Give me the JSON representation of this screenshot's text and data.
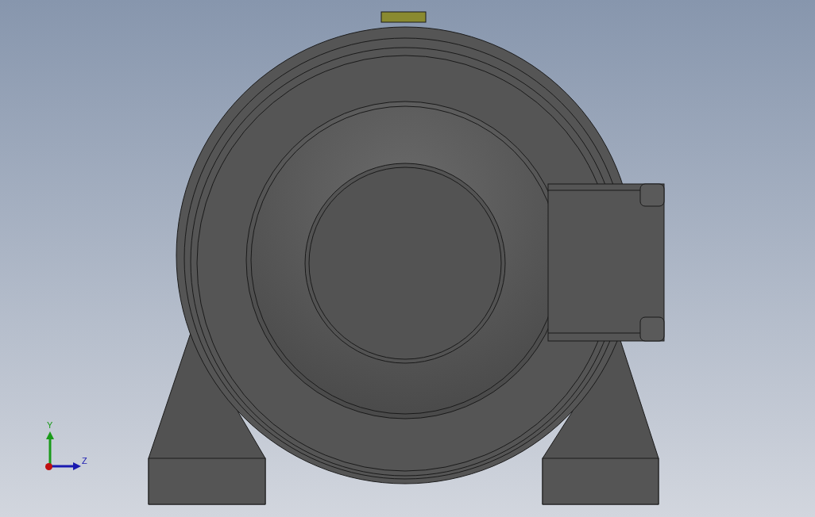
{
  "viewport": {
    "triad": {
      "axes": [
        {
          "kind": "vertical",
          "label": "Y",
          "color": "#1a9a1a"
        },
        {
          "kind": "horizontal",
          "label": "Z",
          "color": "#1a1ab0"
        }
      ]
    }
  }
}
